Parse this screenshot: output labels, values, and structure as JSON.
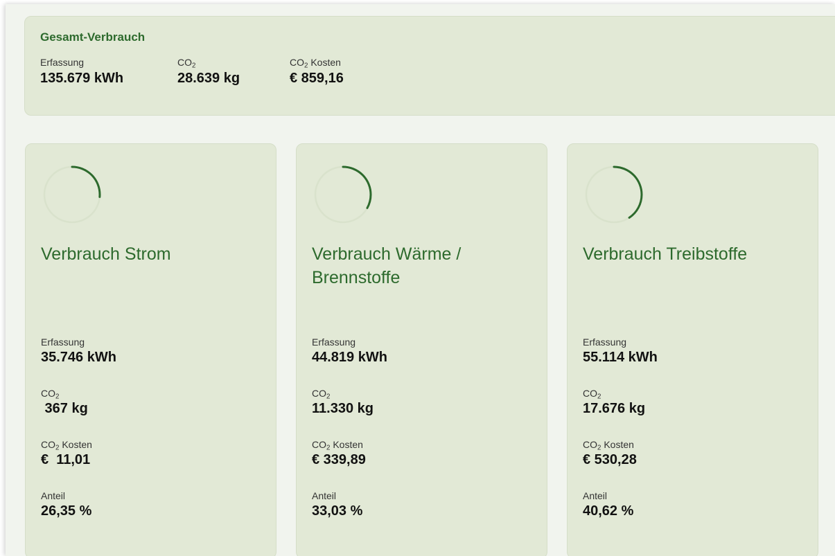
{
  "summary": {
    "title": "Gesamt-Verbrauch",
    "metrics": [
      {
        "label_pre": "Erfassung",
        "label_sub": "",
        "label_post": "",
        "value": "135.679 kWh"
      },
      {
        "label_pre": "CO",
        "label_sub": "2",
        "label_post": "",
        "value": "28.639 kg"
      },
      {
        "label_pre": "CO",
        "label_sub": "2",
        "label_post": " Kosten",
        "value": "€ 859,16"
      }
    ]
  },
  "cards": [
    {
      "title": "Verbrauch Strom",
      "progress": 0.2635,
      "metrics": {
        "erfassung": {
          "label": "Erfassung",
          "value": "35.746 kWh"
        },
        "co2": {
          "label_pre": "CO",
          "label_sub": "2",
          "value": " 367 kg"
        },
        "kosten": {
          "label_pre": "CO",
          "label_sub": "2",
          "label_post": " Kosten",
          "value": "€  11,01"
        },
        "anteil": {
          "label": "Anteil",
          "value": "26,35 %"
        }
      }
    },
    {
      "title": "Verbrauch Wärme / Brennstoffe",
      "progress": 0.3303,
      "metrics": {
        "erfassung": {
          "label": "Erfassung",
          "value": "44.819 kWh"
        },
        "co2": {
          "label_pre": "CO",
          "label_sub": "2",
          "value": "11.330 kg"
        },
        "kosten": {
          "label_pre": "CO",
          "label_sub": "2",
          "label_post": " Kosten",
          "value": "€ 339,89"
        },
        "anteil": {
          "label": "Anteil",
          "value": "33,03 %"
        }
      }
    },
    {
      "title": "Verbrauch Treibstoffe",
      "progress": 0.4062,
      "metrics": {
        "erfassung": {
          "label": "Erfassung",
          "value": "55.114 kWh"
        },
        "co2": {
          "label_pre": "CO",
          "label_sub": "2",
          "value": "17.676 kg"
        },
        "kosten": {
          "label_pre": "CO",
          "label_sub": "2",
          "label_post": " Kosten",
          "value": "€ 530,28"
        },
        "anteil": {
          "label": "Anteil",
          "value": "40,62 %"
        }
      }
    }
  ],
  "colors": {
    "accent": "#2d6a2d",
    "card_bg": "#e2e9d6",
    "track": "#d9e2cc",
    "page_bg": "#f1f4ee"
  }
}
